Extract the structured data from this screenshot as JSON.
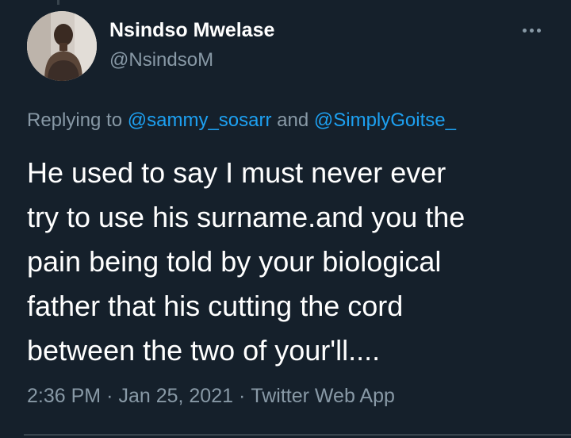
{
  "tweet": {
    "author": {
      "name": "Nsindso Mwelase",
      "handle": "@NsindsoM"
    },
    "reply": {
      "prefix": "Replying to",
      "mention1": "@sammy_sosarr",
      "conjunction": "and",
      "mention2": "@SimplyGoitse_"
    },
    "text_lines": [
      "He used to say I must never ever",
      "try to use his surname.and you the",
      "pain being told by your biological",
      "father that his cutting the cord",
      "between the two of your'll...."
    ],
    "time": "2:36 PM",
    "date": "Jan 25, 2021",
    "source": "Twitter Web App",
    "separator": "·"
  },
  "icons": {
    "more": "more-options-icon",
    "avatar": "profile-photo"
  },
  "colors": {
    "background": "#15202b",
    "text": "#ffffff",
    "muted": "#8899a6",
    "link": "#1da1f2",
    "divider": "#38444d"
  }
}
